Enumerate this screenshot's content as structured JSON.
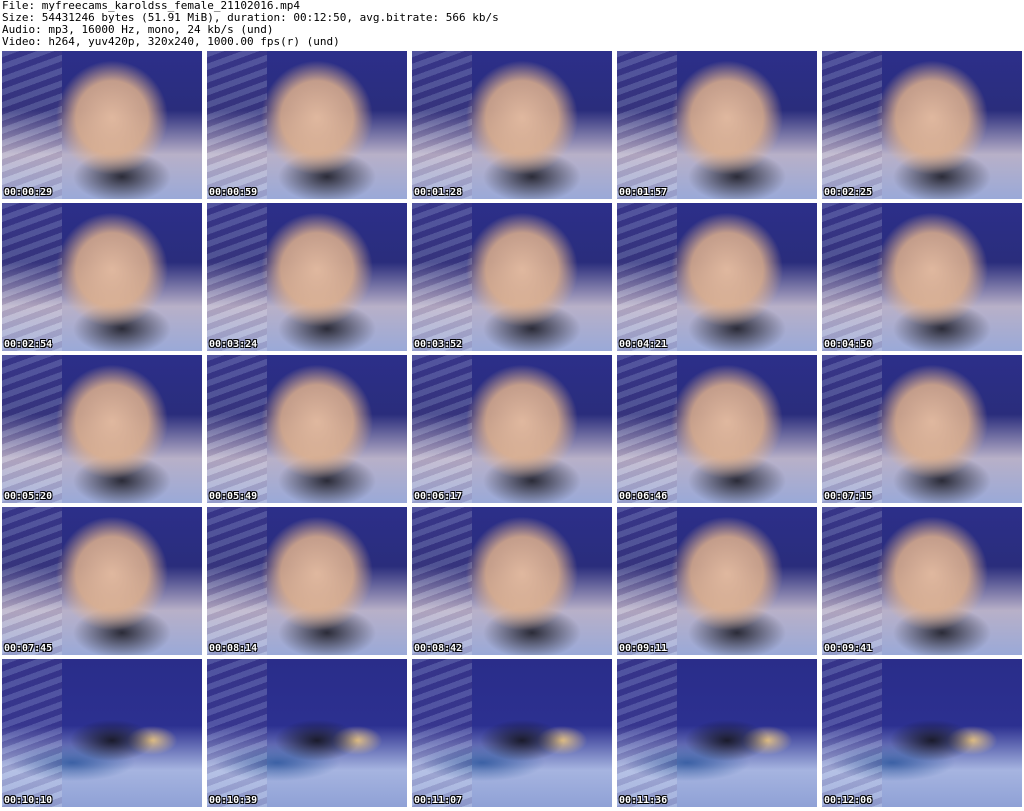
{
  "info": {
    "file": "File: myfreecams_karoldss_female_21102016.mp4",
    "size": "Size: 54431246 bytes (51.91 MiB), duration: 00:12:50, avg.bitrate: 566 kb/s",
    "audio": "Audio: mp3, 16000 Hz, mono, 24 kb/s (und)",
    "video": "Video: h264, yuv420p, 320x240, 1000.00 fps(r) (und)"
  },
  "timestamps": [
    "00:00:29",
    "00:00:59",
    "00:01:28",
    "00:01:57",
    "00:02:25",
    "00:02:54",
    "00:03:24",
    "00:03:52",
    "00:04:21",
    "00:04:50",
    "00:05:20",
    "00:05:49",
    "00:06:17",
    "00:06:46",
    "00:07:15",
    "00:07:45",
    "00:08:14",
    "00:08:42",
    "00:09:11",
    "00:09:41",
    "00:10:10",
    "00:10:39",
    "00:11:07",
    "00:11:36",
    "00:12:06"
  ]
}
